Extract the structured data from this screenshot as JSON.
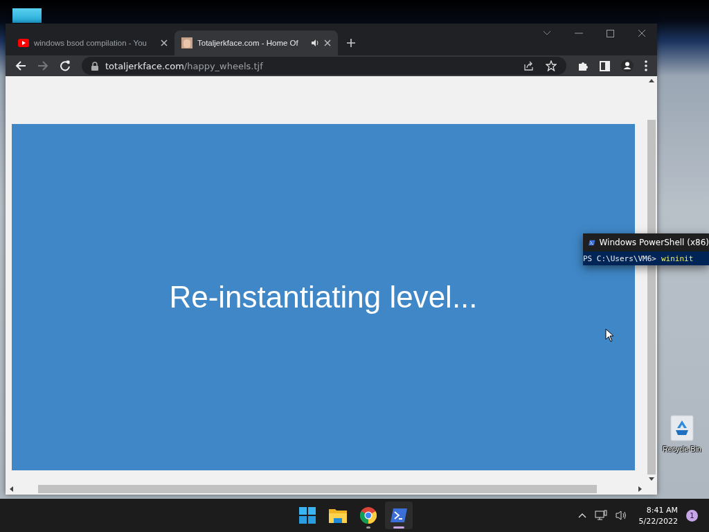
{
  "desktop": {
    "icons": [
      {
        "label": "Recycle Bin"
      }
    ]
  },
  "browser": {
    "tabs": [
      {
        "title": "windows bsod compilation - You",
        "selected": false,
        "audio": false,
        "kind": "video"
      },
      {
        "title": "Totaljerkface.com - Home Of",
        "selected": true,
        "audio": true,
        "kind": "image"
      }
    ],
    "address": {
      "domain": "totaljerkface.com",
      "path": "/happy_wheels.tjf"
    },
    "page": {
      "message": "Re-instantiating level..."
    }
  },
  "powershell_preview": {
    "title": "Windows PowerShell (x86)",
    "prompt": "PS C:\\Users\\VM6>",
    "command": "wininit"
  },
  "taskbar": {
    "apps": [
      {
        "kind": "start",
        "running": false,
        "active": false
      },
      {
        "kind": "explorer",
        "running": false,
        "active": false
      },
      {
        "kind": "chrome",
        "running": true,
        "active": false
      },
      {
        "kind": "powershell",
        "running": true,
        "active": true
      }
    ],
    "time": "8:41 AM",
    "date": "5/22/2022",
    "notifications": "1"
  }
}
